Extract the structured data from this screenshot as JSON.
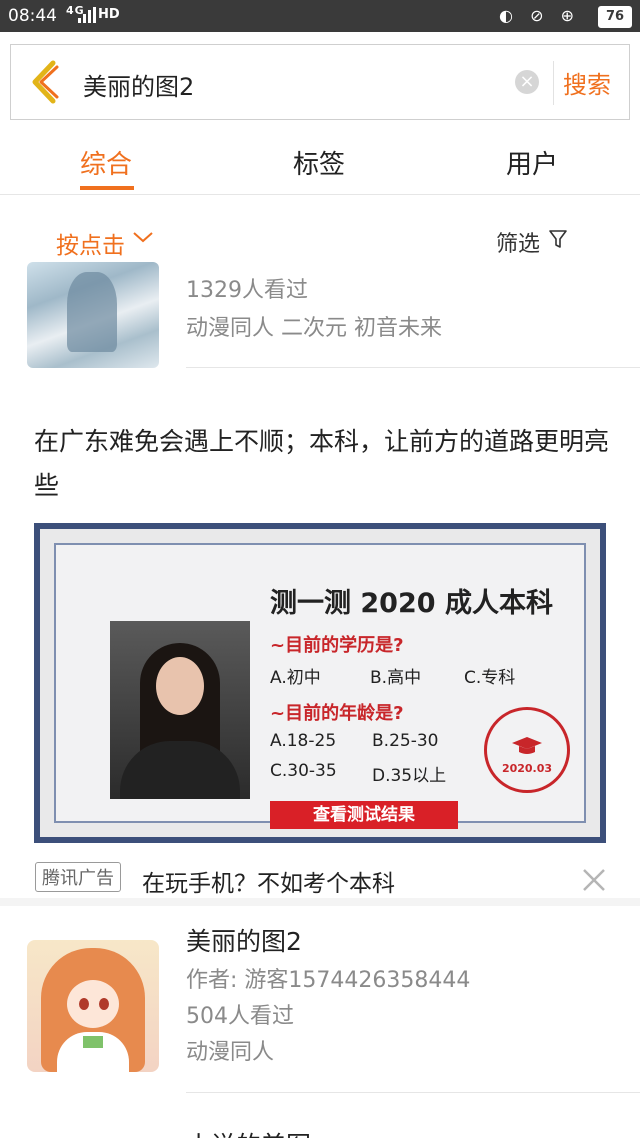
{
  "status_bar": {
    "time": "08:44",
    "network": "4G",
    "hd": "HD",
    "battery": "76"
  },
  "search": {
    "query": "美丽的图2",
    "clear_icon": "close-circle-icon",
    "search_label": "搜索",
    "back_icon": "chevron-left-icon"
  },
  "tabs": [
    {
      "label": "综合",
      "active": true
    },
    {
      "label": "标签",
      "active": false
    },
    {
      "label": "用户",
      "active": false
    }
  ],
  "sort": {
    "label": "按点击",
    "filter_label": "筛选"
  },
  "results": [
    {
      "views": "1329人看过",
      "tags": "动漫同人 二次元 初音未来"
    },
    {
      "title": "美丽的图2",
      "author": "作者: 游客1574426358444",
      "views": "504人看过",
      "tags": "动漫同人"
    },
    {
      "title": "小说的美图"
    }
  ],
  "ad": {
    "title": "在广东难免会遇上不顺；本科，让前方的道路更明亮些",
    "banner_headline": "测一测 2020 成人本科",
    "q1": "~目前的学历是?",
    "q1_opts": [
      "A.初中",
      "B.高中",
      "C.专科"
    ],
    "q2": "~目前的年龄是?",
    "q2_opts": [
      "A.18-25",
      "B.25-30",
      "C.30-35",
      "D.35以上"
    ],
    "stamp_year": "2020.03",
    "cta": "查看测试结果",
    "tag": "腾讯广告",
    "desc": "在玩手机？不如考个本科"
  },
  "colors": {
    "accent": "#f0701e",
    "ad_red": "#d92027",
    "status_bar": "#3a3a3a"
  }
}
